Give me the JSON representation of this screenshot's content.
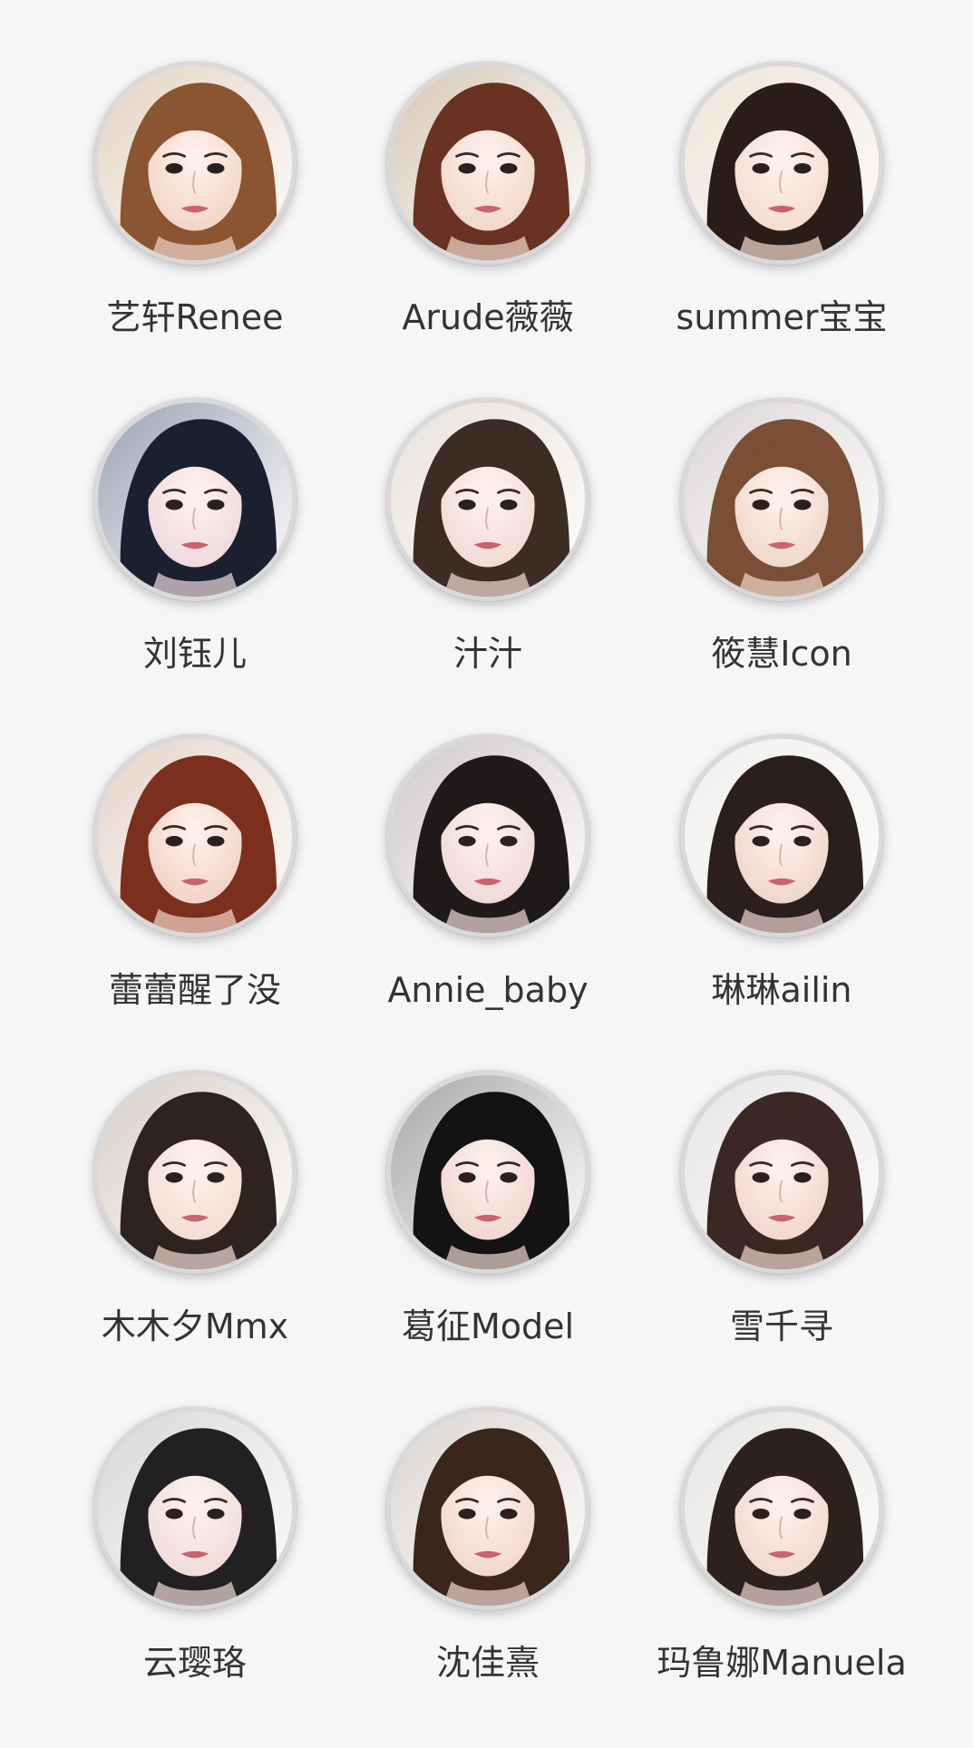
{
  "profiles": [
    {
      "name": "艺轩Renee",
      "hair": "#8a5530",
      "bg": "#e3d3c2",
      "skin": "#f1d6c7"
    },
    {
      "name": "Arude薇薇",
      "hair": "#6a3222",
      "bg": "#d7c7b7",
      "skin": "#f2d8cc"
    },
    {
      "name": "summer宝宝",
      "hair": "#2a1c16",
      "bg": "#efe3d6",
      "skin": "#f5ddd2"
    },
    {
      "name": "刘钰儿",
      "hair": "#1b2031",
      "bg": "#9aa1b3",
      "skin": "#efdade"
    },
    {
      "name": "汁汁",
      "hair": "#3d2c24",
      "bg": "#e9e1da",
      "skin": "#f3dbd6"
    },
    {
      "name": "筱慧Icon",
      "hair": "#7a4f35",
      "bg": "#dcd7d7",
      "skin": "#f0d8cc"
    },
    {
      "name": "蕾蕾醒了没",
      "hair": "#7c2f1d",
      "bg": "#e5d3c8",
      "skin": "#f2d3c7"
    },
    {
      "name": "Annie_baby",
      "hair": "#1f1a1a",
      "bg": "#cfc9c8",
      "skin": "#f0dad6"
    },
    {
      "name": "琳琳ailin",
      "hair": "#2a1f1c",
      "bg": "#f2f0ef",
      "skin": "#f0d6cd"
    },
    {
      "name": "木木夕Mmx",
      "hair": "#2f2320",
      "bg": "#d8cfc8",
      "skin": "#f3ded4"
    },
    {
      "name": "葛征Model",
      "hair": "#141313",
      "bg": "#a7a6a7",
      "skin": "#f0d7d0"
    },
    {
      "name": "雪千寻",
      "hair": "#3b2823",
      "bg": "#e6e4e5",
      "skin": "#f1d7cf"
    },
    {
      "name": "云璎珞",
      "hair": "#222023",
      "bg": "#d8d6d8",
      "skin": "#f0dcd9"
    },
    {
      "name": "沈佳熹",
      "hair": "#3b261c",
      "bg": "#dad5d3",
      "skin": "#f2d8ce"
    },
    {
      "name": "玛鲁娜Manuela",
      "hair": "#2d211d",
      "bg": "#e7e5e3",
      "skin": "#f1d9d0"
    }
  ]
}
